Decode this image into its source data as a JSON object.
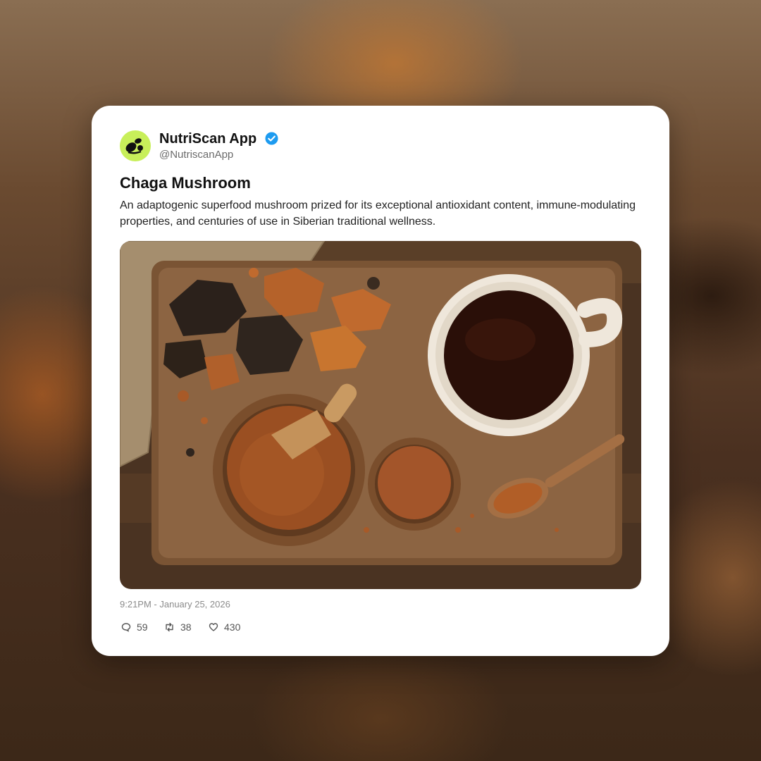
{
  "post": {
    "author_name": "NutriScan App",
    "author_handle": "@NutriscanApp",
    "verified": true,
    "avatar_icon": "leaf-logo-icon",
    "title": "Chaga Mushroom",
    "description": "An adaptogenic superfood mushroom prized for its exceptional antioxidant content, immune-modulating properties, and centuries of use in Siberian traditional wellness.",
    "image_icon": "chaga-mushroom-photo",
    "timestamp": "9:21PM - January 25, 2026",
    "stats": {
      "replies": "59",
      "reposts": "38",
      "likes": "430"
    }
  },
  "colors": {
    "accent_verified": "#1d9bf0",
    "avatar_bg": "#c8ef5a",
    "card_bg": "#ffffff"
  }
}
